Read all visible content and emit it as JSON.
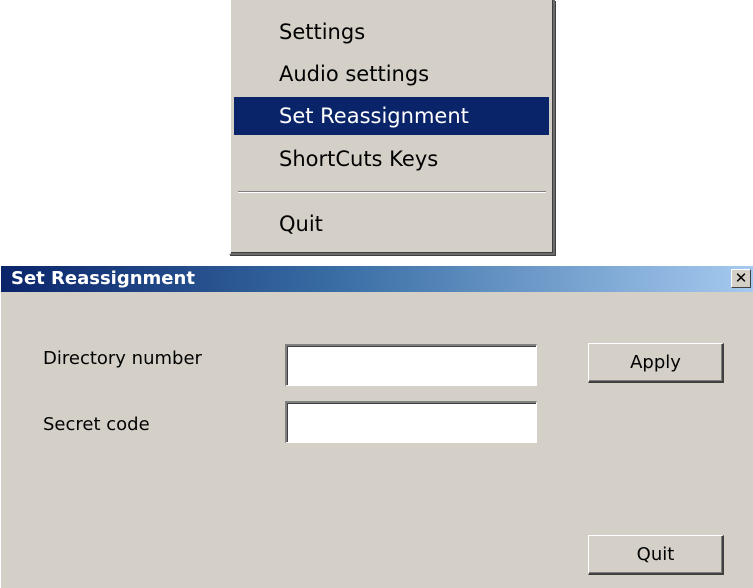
{
  "context_menu": {
    "items": [
      {
        "label": "Settings"
      },
      {
        "label": "Audio settings"
      },
      {
        "label": "Set Reassignment",
        "selected": true
      },
      {
        "label": "ShortCuts Keys"
      },
      {
        "label": "Quit"
      }
    ]
  },
  "dialog": {
    "title": "Set Reassignment",
    "close_glyph": "✕",
    "fields": {
      "directory_number": {
        "label": "Directory number",
        "value": ""
      },
      "secret_code": {
        "label": "Secret code",
        "value": ""
      }
    },
    "buttons": {
      "apply_label": "Apply",
      "quit_label": "Quit"
    }
  },
  "colors": {
    "window_bg": "#d4d0c8",
    "selection_bg": "#0a246a",
    "titlebar_start": "#0a246a",
    "titlebar_end": "#a6caf0"
  }
}
